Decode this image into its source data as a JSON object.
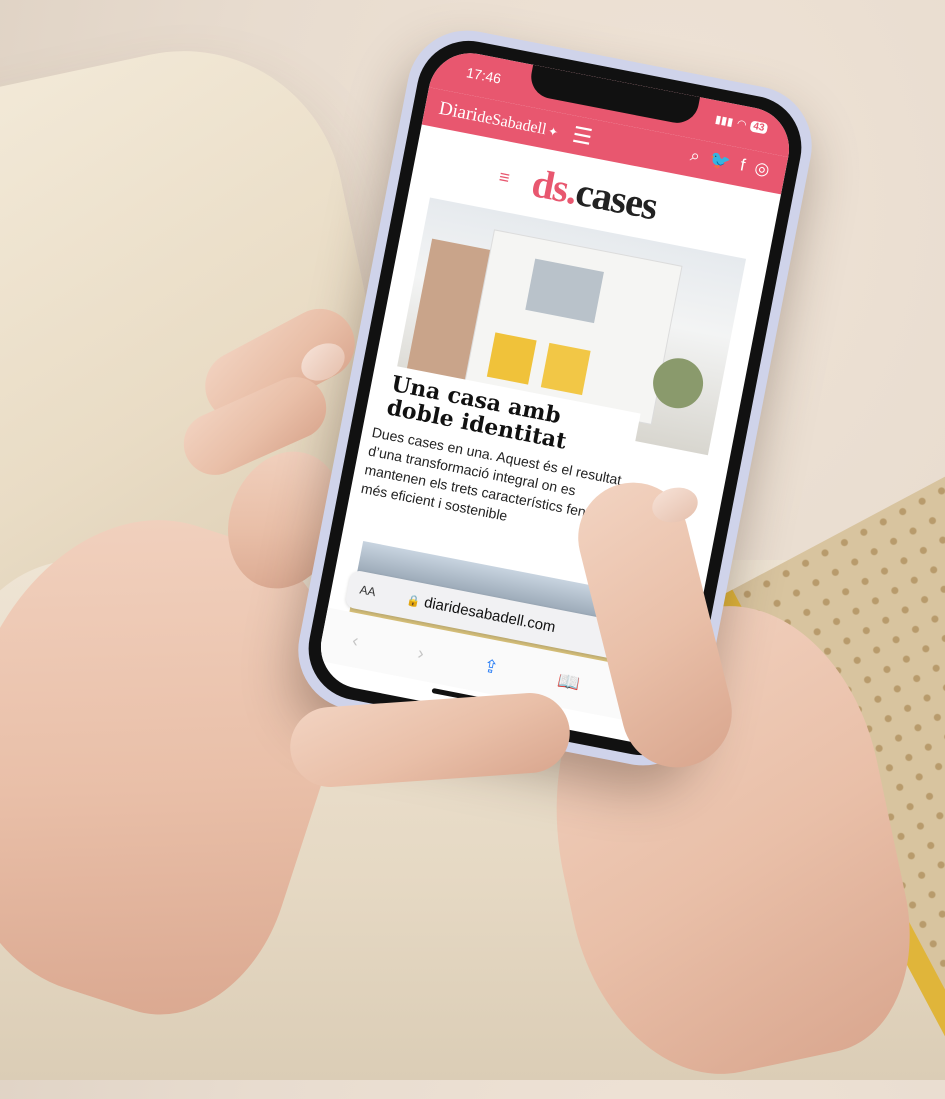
{
  "status": {
    "time": "17:46",
    "signal": "▮▮▮",
    "wifi": "◠",
    "battery": "43"
  },
  "site": {
    "brand_main": "Diari",
    "brand_de": "de",
    "brand_city": "Sabadell",
    "brand_star": "✦",
    "menu_glyph": "☰",
    "social": [
      "⌕",
      "🐦",
      "f",
      "◎"
    ],
    "social_names": [
      "search-icon",
      "twitter-icon",
      "facebook-icon",
      "instagram-icon"
    ]
  },
  "section_logo": {
    "menu_glyph": "≡",
    "part1": "ds",
    "dot": ".",
    "part2": "cases"
  },
  "article": {
    "headline": "Una casa amb doble identitat",
    "summary": "Dues cases en una. Aquest és el resultat d’una transformació integral on es mantenen els trets característics fent-la més eficient i sostenible"
  },
  "browser": {
    "aa": "AA",
    "lock": "🔒",
    "url": "diaridesabadell.com",
    "reload": "↻",
    "toolbar": [
      "‹",
      "›",
      "⇪",
      "📖",
      "⧉"
    ]
  },
  "colors": {
    "brand": "#e8576f",
    "link_blue": "#2a7ef5"
  }
}
